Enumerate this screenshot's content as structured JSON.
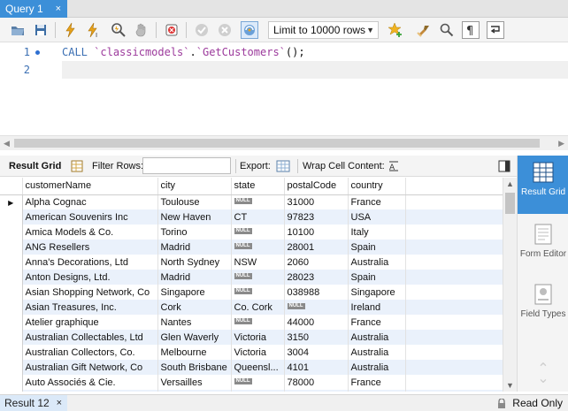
{
  "tab": {
    "title": "Query 1",
    "close": "×"
  },
  "toolbar": {
    "limit_label": "Limit to 10000 rows",
    "icons": [
      "open-file-icon",
      "save-icon",
      "execute-icon",
      "execute-current-icon",
      "explain-icon",
      "stop-icon",
      "toggle-error-icon",
      "commit-icon",
      "rollback-icon",
      "autocommit-icon",
      "dropdown-icon",
      "beautify-icon",
      "brush-icon",
      "find-icon",
      "invisible-chars-icon",
      "wrap-icon"
    ]
  },
  "editor": {
    "line_numbers": [
      "1",
      "2"
    ],
    "code": {
      "keyword": "CALL",
      "schema": "`classicmodels`",
      "dot": ".",
      "proc": "`GetCustomers`",
      "tail": "();"
    }
  },
  "results_toolbar": {
    "result_grid": "Result Grid",
    "filter_rows": "Filter Rows:",
    "export": "Export:",
    "wrap_cell": "Wrap Cell Content:"
  },
  "grid": {
    "columns": [
      "customerName",
      "city",
      "state",
      "postalCode",
      "country"
    ],
    "null_label": "NULL",
    "rows": [
      [
        "Alpha Cognac",
        "Toulouse",
        null,
        "31000",
        "France"
      ],
      [
        "American Souvenirs Inc",
        "New Haven",
        "CT",
        "97823",
        "USA"
      ],
      [
        "Amica Models & Co.",
        "Torino",
        null,
        "10100",
        "Italy"
      ],
      [
        "ANG Resellers",
        "Madrid",
        null,
        "28001",
        "Spain"
      ],
      [
        "Anna's Decorations, Ltd",
        "North Sydney",
        "NSW",
        "2060",
        "Australia"
      ],
      [
        "Anton Designs, Ltd.",
        "Madrid",
        null,
        "28023",
        "Spain"
      ],
      [
        "Asian Shopping Network, Co",
        "Singapore",
        null,
        "038988",
        "Singapore"
      ],
      [
        "Asian Treasures, Inc.",
        "Cork",
        "Co. Cork",
        null,
        "Ireland"
      ],
      [
        "Atelier graphique",
        "Nantes",
        null,
        "44000",
        "France"
      ],
      [
        "Australian Collectables, Ltd",
        "Glen Waverly",
        "Victoria",
        "3150",
        "Australia"
      ],
      [
        "Australian Collectors, Co.",
        "Melbourne",
        "Victoria",
        "3004",
        "Australia"
      ],
      [
        "Australian Gift Network, Co",
        "South Brisbane",
        "Queensl...",
        "4101",
        "Australia"
      ],
      [
        "Auto Associés & Cie.",
        "Versailles",
        null,
        "78000",
        "France"
      ],
      [
        "",
        "",
        "",
        "",
        ""
      ]
    ]
  },
  "side_panel": {
    "result_grid": "Result Grid",
    "form_editor": "Form Editor",
    "field_types": "Field Types"
  },
  "status": {
    "result_tab": "Result 12",
    "close": "×",
    "read_only": "Read Only"
  },
  "colors": {
    "accent": "#3c8fd8",
    "row_alt": "#eaf1fb",
    "keyword": "#3b6fb3",
    "identifier": "#9c3a9c"
  }
}
